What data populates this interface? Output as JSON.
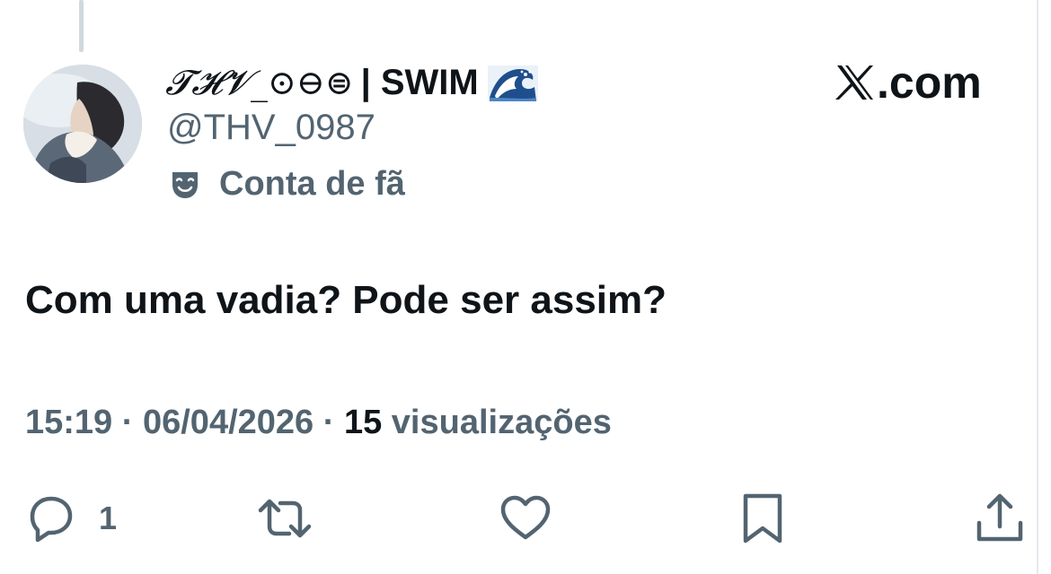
{
  "author": {
    "display_name_script": "𝓣𝓗𝓥_⊙⊖⊜",
    "display_name_bold": "| SWIM",
    "display_name_emoji": "wave-emoji-icon",
    "handle": "@THV_0987",
    "fan_badge_label": "Conta de fã",
    "fan_badge_icon": "theater-mask-icon"
  },
  "branding": {
    "logo_text": ".com",
    "logo_icon": "x-logo-icon"
  },
  "tweet": {
    "text": "Com uma vadia? Pode ser assim?"
  },
  "meta": {
    "time": "15:19",
    "separator": "·",
    "date": "06/04/2026",
    "views_count": "15",
    "views_label": "visualizações"
  },
  "actions": {
    "reply_count": "1",
    "icons": [
      "reply-icon",
      "retweet-icon",
      "like-icon",
      "bookmark-icon",
      "share-icon"
    ]
  },
  "colors": {
    "text_primary": "#0f1419",
    "text_secondary": "#536471",
    "thread_line": "#cfd9de",
    "background": "#ffffff"
  }
}
